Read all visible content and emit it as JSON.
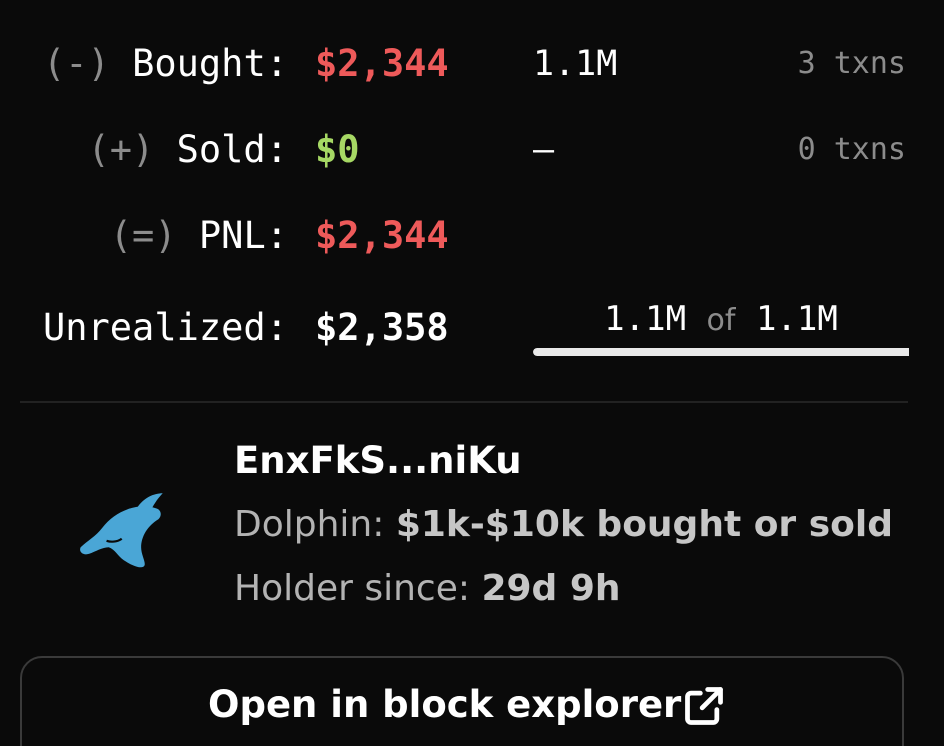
{
  "colors": {
    "negative": "#ee5a5a",
    "positive": "#a6d864",
    "neutral": "#ffffff",
    "muted": "#8c8c8c",
    "dolphin": "#4aa6d6"
  },
  "stats": {
    "bought": {
      "sign": "(-)",
      "label": "Bought:",
      "value": "$2,344",
      "amount": "1.1M",
      "txns": "3 txns"
    },
    "sold": {
      "sign": "(+)",
      "label": "Sold:",
      "value": "$0",
      "amount": "–",
      "txns": "0 txns"
    },
    "pnl": {
      "sign": "(=)",
      "label": "PNL:",
      "value": "$2,344"
    },
    "unrealized": {
      "label": "Unrealized:",
      "value": "$2,358"
    }
  },
  "holdings": {
    "held": "1.1M",
    "of_text": "of",
    "total": "1.1M",
    "fraction": 1.0
  },
  "wallet": {
    "icon": "dolphin-icon",
    "address": "EnxFkS...niKu",
    "tier_label": "Dolphin:",
    "tier_desc": "$1k-$10k bought or sold",
    "holder_since_label": "Holder since:",
    "holder_since": "29d 9h"
  },
  "explorer_button": {
    "label": "Open in block explorer",
    "icon": "external-link-icon"
  }
}
